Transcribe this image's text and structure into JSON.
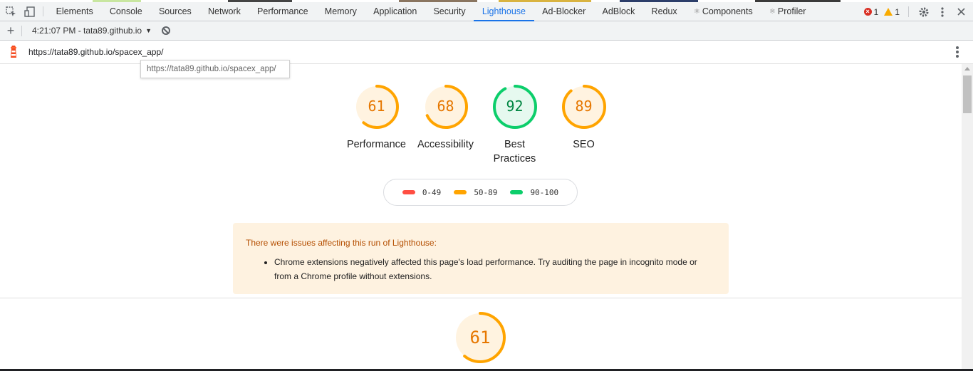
{
  "colors": {
    "fail": "#ff4e42",
    "average": "#ffa400",
    "pass": "#0cce6b",
    "average_text": "#e67700",
    "pass_text": "#018642",
    "average_bg": "#fff3e0",
    "pass_bg": "#e6f9ef",
    "accent": "#1a73e8"
  },
  "devtools": {
    "tabs": [
      {
        "label": "Elements"
      },
      {
        "label": "Console"
      },
      {
        "label": "Sources"
      },
      {
        "label": "Network"
      },
      {
        "label": "Performance"
      },
      {
        "label": "Memory"
      },
      {
        "label": "Application"
      },
      {
        "label": "Security"
      },
      {
        "label": "Lighthouse"
      },
      {
        "label": "Ad-Blocker"
      },
      {
        "label": "AdBlock"
      },
      {
        "label": "Redux"
      },
      {
        "label": "Components",
        "icon": "react-icon"
      },
      {
        "label": "Profiler",
        "icon": "react-icon"
      }
    ],
    "active_tab": "Lighthouse",
    "error_count": "1",
    "warning_count": "1"
  },
  "toolbar": {
    "report_label": "4:21:07 PM - tata89.github.io"
  },
  "url": {
    "text": "https://tata89.github.io/spacex_app/",
    "tooltip": "https://tata89.github.io/spacex_app/"
  },
  "gauges": [
    {
      "score": 61,
      "label": "Performance",
      "level": "average"
    },
    {
      "score": 68,
      "label": "Accessibility",
      "level": "average"
    },
    {
      "score": 92,
      "label": "Best Practices",
      "level": "pass"
    },
    {
      "score": 89,
      "label": "SEO",
      "level": "average"
    }
  ],
  "legend": [
    {
      "label": "0-49",
      "level": "fail"
    },
    {
      "label": "50-89",
      "level": "average"
    },
    {
      "label": "90-100",
      "level": "pass"
    }
  ],
  "warning": {
    "title": "There were issues affecting this run of Lighthouse:",
    "items": [
      "Chrome extensions negatively affected this page's load performance. Try auditing the page in incognito mode or from a Chrome profile without extensions."
    ]
  },
  "performance_section": {
    "score": 61,
    "level": "average"
  }
}
